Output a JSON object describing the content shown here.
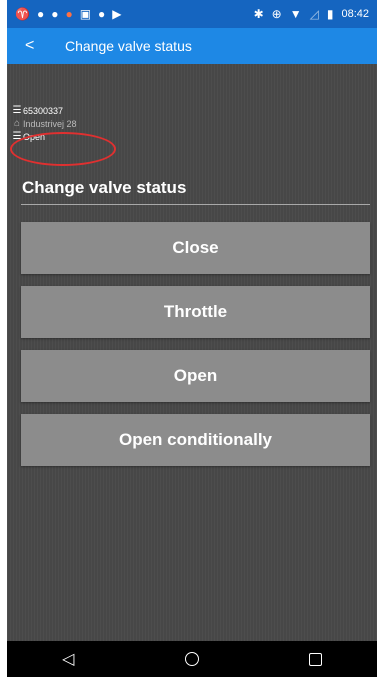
{
  "status_bar": {
    "time": "08:42",
    "left_icons": [
      "signal-icon",
      "notification-icon",
      "notification-icon",
      "app-icon",
      "calendar-icon",
      "app-icon",
      "play-icon"
    ],
    "right_icons": [
      "bluetooth-icon",
      "data-icon",
      "wifi-icon",
      "no-signal-icon",
      "battery-icon"
    ]
  },
  "app_bar": {
    "back_glyph": "<",
    "title": "Change valve status"
  },
  "valve_info": {
    "id": "65300337",
    "address": "Industrivej 28",
    "status": "Open"
  },
  "section": {
    "title": "Change valve status"
  },
  "actions": [
    {
      "label": "Close"
    },
    {
      "label": "Throttle"
    },
    {
      "label": "Open"
    },
    {
      "label": "Open conditionally"
    }
  ],
  "colors": {
    "status_bar": "#1565c0",
    "app_bar": "#1e88e5",
    "background": "#474747",
    "button": "#8c8c8c",
    "highlight_circle": "#e03030"
  }
}
